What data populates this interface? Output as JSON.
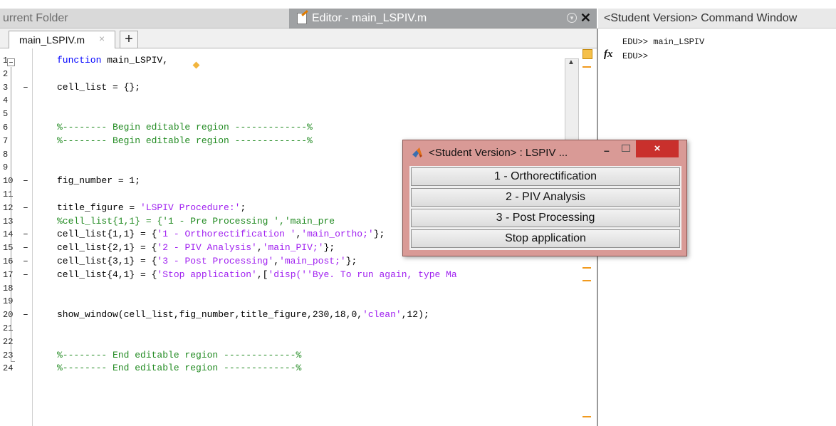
{
  "panels": {
    "current_folder_title": "urrent Folder",
    "editor_title": "Editor - main_LSPIV.m",
    "command_window_title": "<Student Version> Command Window"
  },
  "editor": {
    "tab_label": "main_LSPIV.m",
    "tab_close": "×",
    "tab_add": "+",
    "lines": [
      {
        "num": "1",
        "mark": "",
        "segs": [
          {
            "t": "function ",
            "c": "kw"
          },
          {
            "t": "main_LSPIV,",
            "c": "plain"
          }
        ]
      },
      {
        "num": "2",
        "mark": "",
        "segs": []
      },
      {
        "num": "3",
        "mark": "–",
        "segs": [
          {
            "t": "cell_list = {};",
            "c": "plain"
          }
        ]
      },
      {
        "num": "4",
        "mark": "",
        "segs": []
      },
      {
        "num": "5",
        "mark": "",
        "segs": []
      },
      {
        "num": "6",
        "mark": "",
        "segs": [
          {
            "t": "%-------- Begin editable region -------------%",
            "c": "cmt"
          }
        ]
      },
      {
        "num": "7",
        "mark": "",
        "segs": [
          {
            "t": "%-------- Begin editable region -------------%",
            "c": "cmt"
          }
        ]
      },
      {
        "num": "8",
        "mark": "",
        "segs": []
      },
      {
        "num": "9",
        "mark": "",
        "segs": []
      },
      {
        "num": "10",
        "mark": "–",
        "segs": [
          {
            "t": "fig_number = 1;",
            "c": "plain"
          }
        ]
      },
      {
        "num": "11",
        "mark": "",
        "segs": []
      },
      {
        "num": "12",
        "mark": "–",
        "segs": [
          {
            "t": "title_figure = ",
            "c": "plain"
          },
          {
            "t": "'LSPIV Procedure:'",
            "c": "str"
          },
          {
            "t": ";",
            "c": "plain"
          }
        ]
      },
      {
        "num": "13",
        "mark": "",
        "segs": [
          {
            "t": "%cell_list{1,1} = {'1 - Pre Processing ','main_pre",
            "c": "cmt"
          }
        ]
      },
      {
        "num": "14",
        "mark": "–",
        "segs": [
          {
            "t": "cell_list{1,1} = {",
            "c": "plain"
          },
          {
            "t": "'1 - Orthorectification '",
            "c": "str"
          },
          {
            "t": ",",
            "c": "plain"
          },
          {
            "t": "'main_ortho;'",
            "c": "str"
          },
          {
            "t": "};",
            "c": "plain"
          }
        ]
      },
      {
        "num": "15",
        "mark": "–",
        "segs": [
          {
            "t": "cell_list{2,1} = {",
            "c": "plain"
          },
          {
            "t": "'2 - PIV Analysis'",
            "c": "str"
          },
          {
            "t": ",",
            "c": "plain"
          },
          {
            "t": "'main_PIV;'",
            "c": "str"
          },
          {
            "t": "};",
            "c": "plain"
          }
        ]
      },
      {
        "num": "16",
        "mark": "–",
        "segs": [
          {
            "t": "cell_list{3,1} = {",
            "c": "plain"
          },
          {
            "t": "'3 - Post Processing'",
            "c": "str"
          },
          {
            "t": ",",
            "c": "plain"
          },
          {
            "t": "'main_post;'",
            "c": "str"
          },
          {
            "t": "};",
            "c": "plain"
          }
        ]
      },
      {
        "num": "17",
        "mark": "–",
        "segs": [
          {
            "t": "cell_list{4,1} = {",
            "c": "plain"
          },
          {
            "t": "'Stop application'",
            "c": "str"
          },
          {
            "t": ",[",
            "c": "plain"
          },
          {
            "t": "'disp(''Bye. To run again, type Ma",
            "c": "str"
          }
        ]
      },
      {
        "num": "18",
        "mark": "",
        "segs": []
      },
      {
        "num": "19",
        "mark": "",
        "segs": []
      },
      {
        "num": "20",
        "mark": "–",
        "segs": [
          {
            "t": "show_window(cell_list,fig_number,title_figure,230,18,0,",
            "c": "plain"
          },
          {
            "t": "'clean'",
            "c": "str"
          },
          {
            "t": ",12);",
            "c": "plain"
          }
        ]
      },
      {
        "num": "21",
        "mark": "",
        "segs": []
      },
      {
        "num": "22",
        "mark": "",
        "segs": []
      },
      {
        "num": "23",
        "mark": "",
        "segs": [
          {
            "t": "%-------- End editable region -------------%",
            "c": "cmt"
          }
        ]
      },
      {
        "num": "24",
        "mark": "",
        "segs": [
          {
            "t": "%-------- End editable region -------------%",
            "c": "cmt"
          }
        ]
      }
    ]
  },
  "command_window": {
    "lines": [
      "EDU>> main_LSPIV",
      "EDU>>"
    ],
    "fx_label": "fx"
  },
  "dialog": {
    "title": "<Student Version> : LSPIV ...",
    "min_label": "–",
    "close_label": "×",
    "buttons": [
      "1 - Orthorectification",
      "2 - PIV Analysis",
      "3 - Post Processing",
      "Stop application"
    ]
  },
  "colors": {
    "keyword": "#0000ff",
    "string": "#a020f0",
    "comment": "#228b22",
    "dialog_frame": "#d99a96",
    "close_button": "#c9302c",
    "warning_marker": "#f19a1e"
  }
}
